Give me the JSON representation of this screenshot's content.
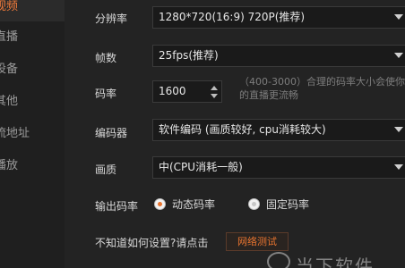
{
  "sidebar": {
    "items": [
      {
        "label": "视频",
        "active": true
      },
      {
        "label": "直播",
        "active": false
      },
      {
        "label": "设备",
        "active": false
      },
      {
        "label": "其他",
        "active": false
      },
      {
        "label": "流地址",
        "active": false
      },
      {
        "label": "播放",
        "active": false
      }
    ]
  },
  "settings": {
    "resolution": {
      "label": "分辨率",
      "value": "1280*720(16:9) 720P(推荐)"
    },
    "fps": {
      "label": "帧数",
      "value": "25fps(推荐)"
    },
    "bitrate": {
      "label": "码率",
      "value": "1600",
      "hint": "（400-3000）合理的码率大小会使你的直播更流畅"
    },
    "encoder": {
      "label": "编码器",
      "value": "软件编码 (画质较好, cpu消耗较大)"
    },
    "quality": {
      "label": "画质",
      "value": "中(CPU消耗一般)"
    },
    "output_bitrate": {
      "label": "输出码率",
      "options": [
        {
          "label": "动态码率",
          "selected": true
        },
        {
          "label": "固定码率",
          "selected": false
        }
      ]
    }
  },
  "help": {
    "text": "不知道如何设置?请点击",
    "button_label": "网络测试"
  },
  "watermark": {
    "text": "当下软件"
  },
  "colors": {
    "accent": "#e8742f",
    "background": "#232323",
    "sidebar": "#1f1f1f"
  }
}
